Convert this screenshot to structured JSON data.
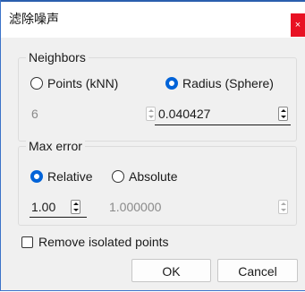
{
  "window": {
    "title": "滤除噪声",
    "close_label": "×"
  },
  "neighbors": {
    "label": "Neighbors",
    "option_knn": "Points (kNN)",
    "option_radius": "Radius (Sphere)",
    "selected": "radius",
    "knn_value": "6",
    "radius_value": "0.040427"
  },
  "max_error": {
    "label": "Max error",
    "option_relative": "Relative",
    "option_absolute": "Absolute",
    "selected": "relative",
    "relative_value": "1.00",
    "absolute_value": "1.000000"
  },
  "remove_isolated": {
    "label": "Remove isolated points",
    "checked": false
  },
  "buttons": {
    "ok": "OK",
    "cancel": "Cancel"
  }
}
